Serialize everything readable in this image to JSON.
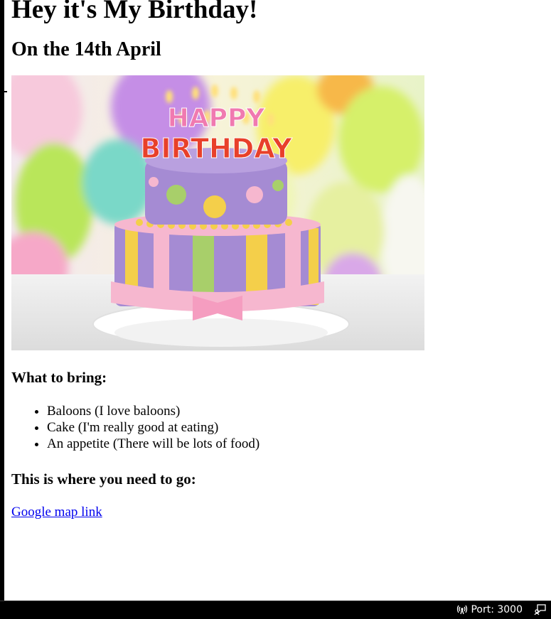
{
  "page": {
    "title": "Hey it's My Birthday!",
    "subtitle": "On the 14th April",
    "image_alt": "HAPPY BIRTHDAY cake",
    "cake_topper_line1": "HAPPY",
    "cake_topper_line2": "BIRTHDAY",
    "bring_heading": "What to bring:",
    "bring_items": [
      "Baloons (I love baloons)",
      "Cake (I'm really good at eating)",
      "An appetite (There will be lots of food)"
    ],
    "location_heading": "This is where you need to go:",
    "map_link": "Google map link"
  },
  "statusbar": {
    "port_label": "Port: 3000",
    "port_icon": "broadcast-icon",
    "feedback_icon": "feedback-icon"
  },
  "colors": {
    "link": "#0000ee",
    "statusbar_bg": "#000000",
    "statusbar_text": "#ffffff",
    "cake_purple": "#a58bd3",
    "cake_pink": "#f6b7cf",
    "cake_yellow": "#f4cf4a",
    "cake_green": "#a8cf6a"
  }
}
